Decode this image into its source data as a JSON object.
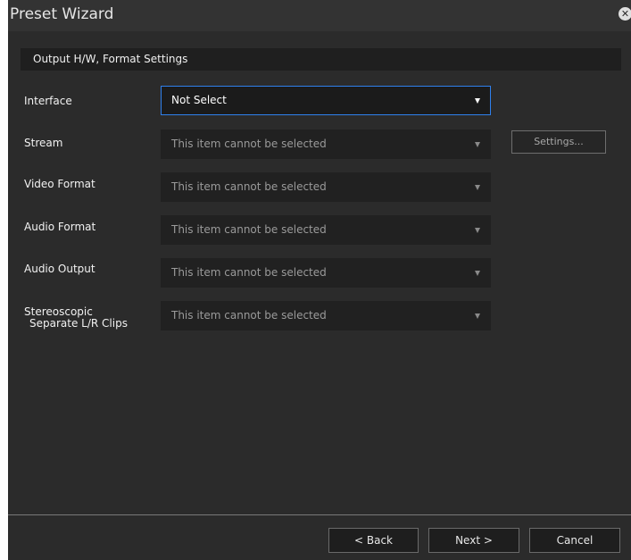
{
  "window": {
    "title": "Preset Wizard",
    "close_glyph": "✕"
  },
  "section": {
    "title": "Output H/W, Format Settings"
  },
  "fields": [
    {
      "label": "Interface",
      "value": "Not Select"
    },
    {
      "label": "Stream",
      "value": "This item cannot be selected"
    },
    {
      "label": "Video Format",
      "value": "This item cannot be selected"
    },
    {
      "label": "Audio Format",
      "value": "This item cannot be selected"
    },
    {
      "label": "Audio Output",
      "value": "This item cannot be selected"
    },
    {
      "label_line1": "Stereoscopic",
      "label_line2": "Separate L/R Clips",
      "value": "This item cannot be selected"
    }
  ],
  "stream_settings_label": "Settings...",
  "footer": {
    "back_label": "< Back",
    "next_label": "Next >",
    "cancel_label": "Cancel"
  },
  "colors": {
    "background": "#2b2b2b",
    "accent_border": "#2f80ed",
    "field_bg": "#212121"
  }
}
